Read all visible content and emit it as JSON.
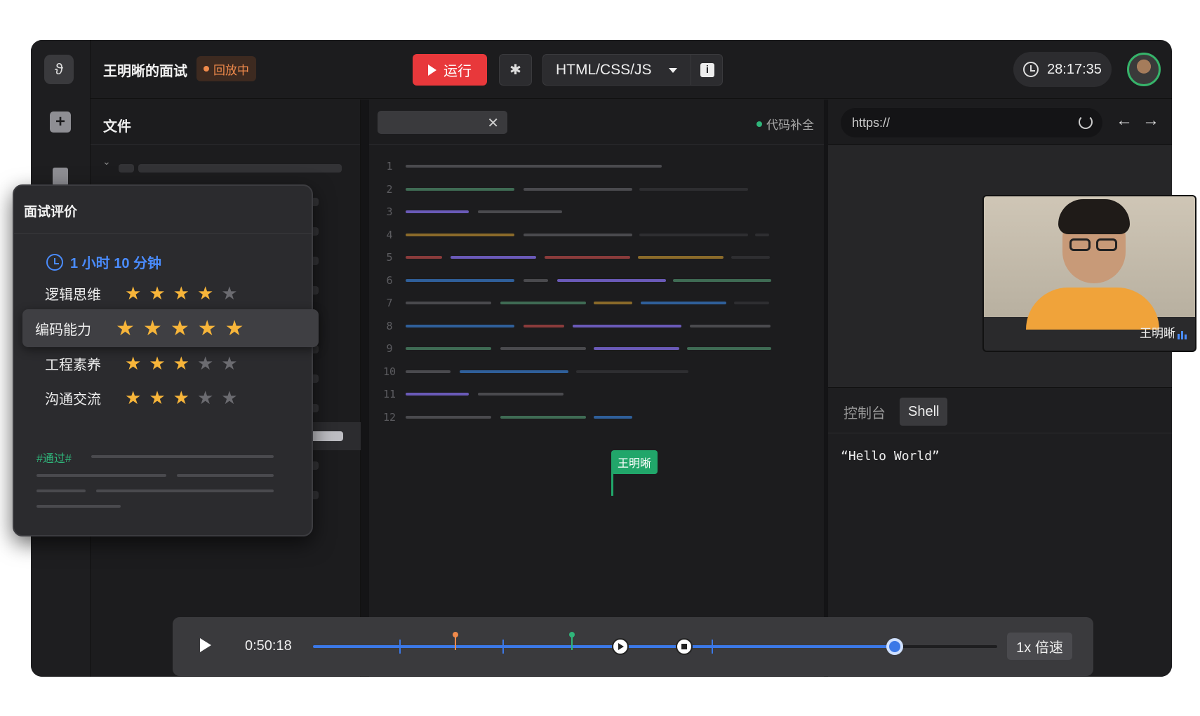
{
  "header": {
    "interview_title": "王明晰的面试",
    "status_badge": "回放中",
    "run_label": "运行",
    "language": "HTML/CSS/JS",
    "info_icon": "i",
    "timer": "28:17:35"
  },
  "files": {
    "title": "文件"
  },
  "editor": {
    "tab_close": "✕",
    "autocomplete_label": "代码补全",
    "line_numbers": [
      "1",
      "2",
      "3",
      "4",
      "5",
      "6",
      "7",
      "8",
      "9",
      "10",
      "11",
      "12"
    ],
    "cursor_user": "王明晰"
  },
  "browser": {
    "url": "https://",
    "back": "←",
    "forward": "→"
  },
  "console": {
    "tab_console": "控制台",
    "tab_shell": "Shell",
    "output": "“Hello World”"
  },
  "video": {
    "participant_name": "王明晰"
  },
  "evaluation": {
    "title": "面试评价",
    "duration": "1 小时 10 分钟",
    "criteria": [
      {
        "label": "逻辑思维",
        "stars": 4,
        "max": 5
      },
      {
        "label": "编码能力",
        "stars": 5,
        "max": 5
      },
      {
        "label": "工程素养",
        "stars": 3,
        "max": 5
      },
      {
        "label": "沟通交流",
        "stars": 3,
        "max": 5
      }
    ],
    "tag": "#通过#"
  },
  "player": {
    "current_time": "0:50:18",
    "speed_label": "1x 倍速",
    "progress": 0.849
  },
  "icons": {
    "logo": "logo-icon",
    "add": "plus-icon",
    "doc": "document-icon",
    "bug": "bug-icon",
    "clock": "clock-icon",
    "refresh": "refresh-icon",
    "play": "play-icon"
  },
  "colors": {
    "run": "#e8383b",
    "accent": "#3b78e7",
    "star": "#f7b53a",
    "success": "#2fb57a",
    "replay": "#f08a4b"
  }
}
